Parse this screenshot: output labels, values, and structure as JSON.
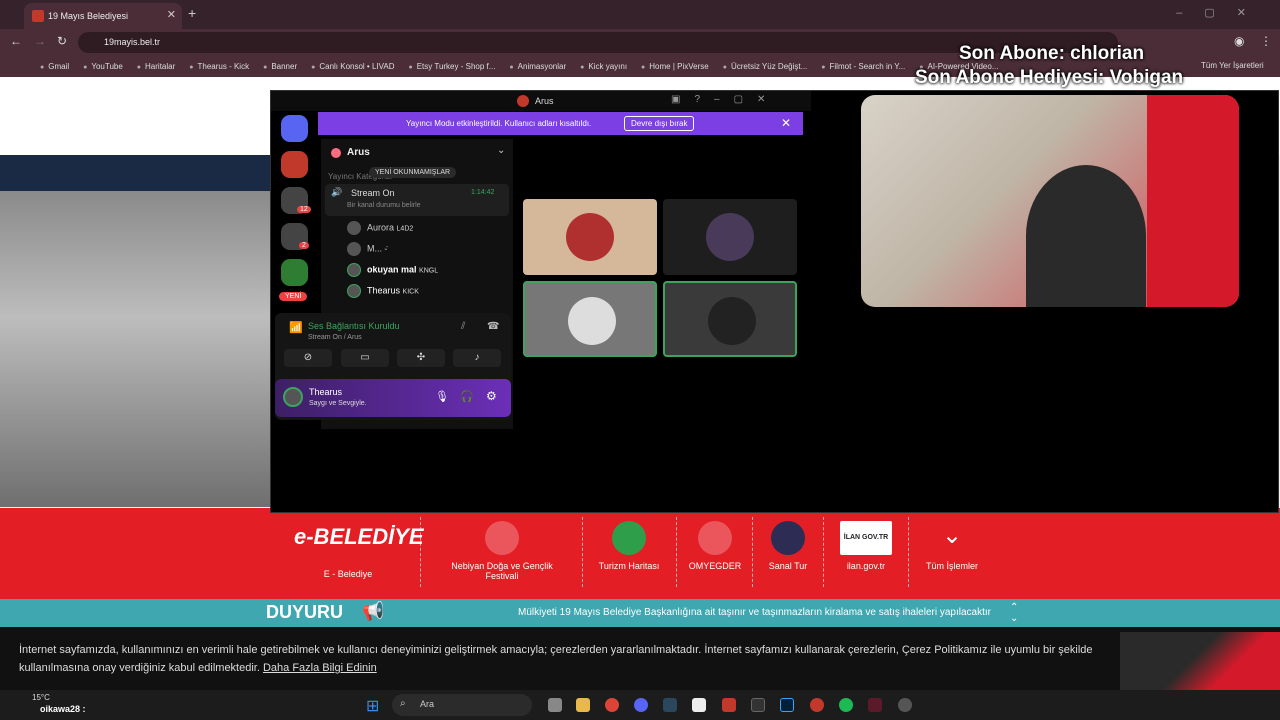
{
  "browser": {
    "tab_title": "19 Mayıs Belediyesi",
    "url": "19mayis.bel.tr",
    "bookmarks": [
      "Gmail",
      "YouTube",
      "Haritalar",
      "Thearus - Kick",
      "Banner",
      "Canlı Konsol • LIVAD",
      "Etsy Turkey - Shop f...",
      "Animasyonlar",
      "Kick yayını",
      "Home | PixVerse",
      "Ücretsiz Yüz Değişt...",
      "Filmot - Search in Y...",
      "AI-Powered Video..."
    ],
    "all_bookmarks": "Tüm Yer İşaretleri"
  },
  "overlay": {
    "last_sub": "Son Abone: chlorian",
    "last_gift": "Son Abone Hediyesi: Vobigan"
  },
  "discord": {
    "window_title": "Arus",
    "streamer_banner": "Yayıncı Modu etkinleştirildi. Kullanıcı adları kısaltıldı.",
    "disable_button": "Devre dışı bırak",
    "server_name": "Arus",
    "category": "Yayıncı Kategorisi",
    "unread_pill": "YENİ OKUNMAMIŞLAR",
    "channel_name": "Stream On",
    "channel_timer": "1:14:42",
    "channel_status": "Bir kanal durumu belirle",
    "members": [
      {
        "name": "Aurora",
        "tag": "L4D2"
      },
      {
        "name": "M...",
        "tag": "ᵕ̈"
      },
      {
        "name": "okuyan mal",
        "tag": "KNGL"
      },
      {
        "name": "Thearus",
        "tag": "KICK"
      }
    ],
    "new_badge": "YENİ",
    "server_badges": [
      "12",
      "2"
    ],
    "voice_status": "Ses Bağlantısı Kuruldu",
    "voice_sub": "Stream On / Arus",
    "user_name": "Thearus",
    "user_status": "Saygı ve Sevgiyle."
  },
  "site": {
    "services": [
      "E - Belediye",
      "Nebiyan Doğa ve Gençlik Festivali",
      "Turizm Haritası",
      "OMYEGDER",
      "Sanal Tur",
      "ilan.gov.tr",
      "Tüm İşlemler"
    ],
    "ebelediye_logo": "e-BELEDİYE",
    "ilan_logo": "İLAN GOV.TR",
    "duyuru_title": "DUYURU",
    "duyuru_text": "Mülkiyeti 19 Mayıs Belediye Başkanlığına ait taşınır ve taşınmazların kiralama ve satış ihaleleri yapılacaktır",
    "cookie_text": "İnternet sayfamızda, kullanımınızı en verimli hale getirebilmek ve kullanıcı deneyiminizi geliştirmek amacıyla; çerezlerden yararlanılmaktadır. İnternet sayfamızı kullanarak çerezlerin, Çerez Politikamız ile uyumlu bir şekilde kullanılmasına onay verdiğiniz kabul edilmektedir.",
    "cookie_link": "Daha Fazla Bilgi Edinin"
  },
  "taskbar": {
    "temperature": "15°C",
    "chat_user": "oikawa28 :",
    "search_placeholder": "Ara"
  }
}
